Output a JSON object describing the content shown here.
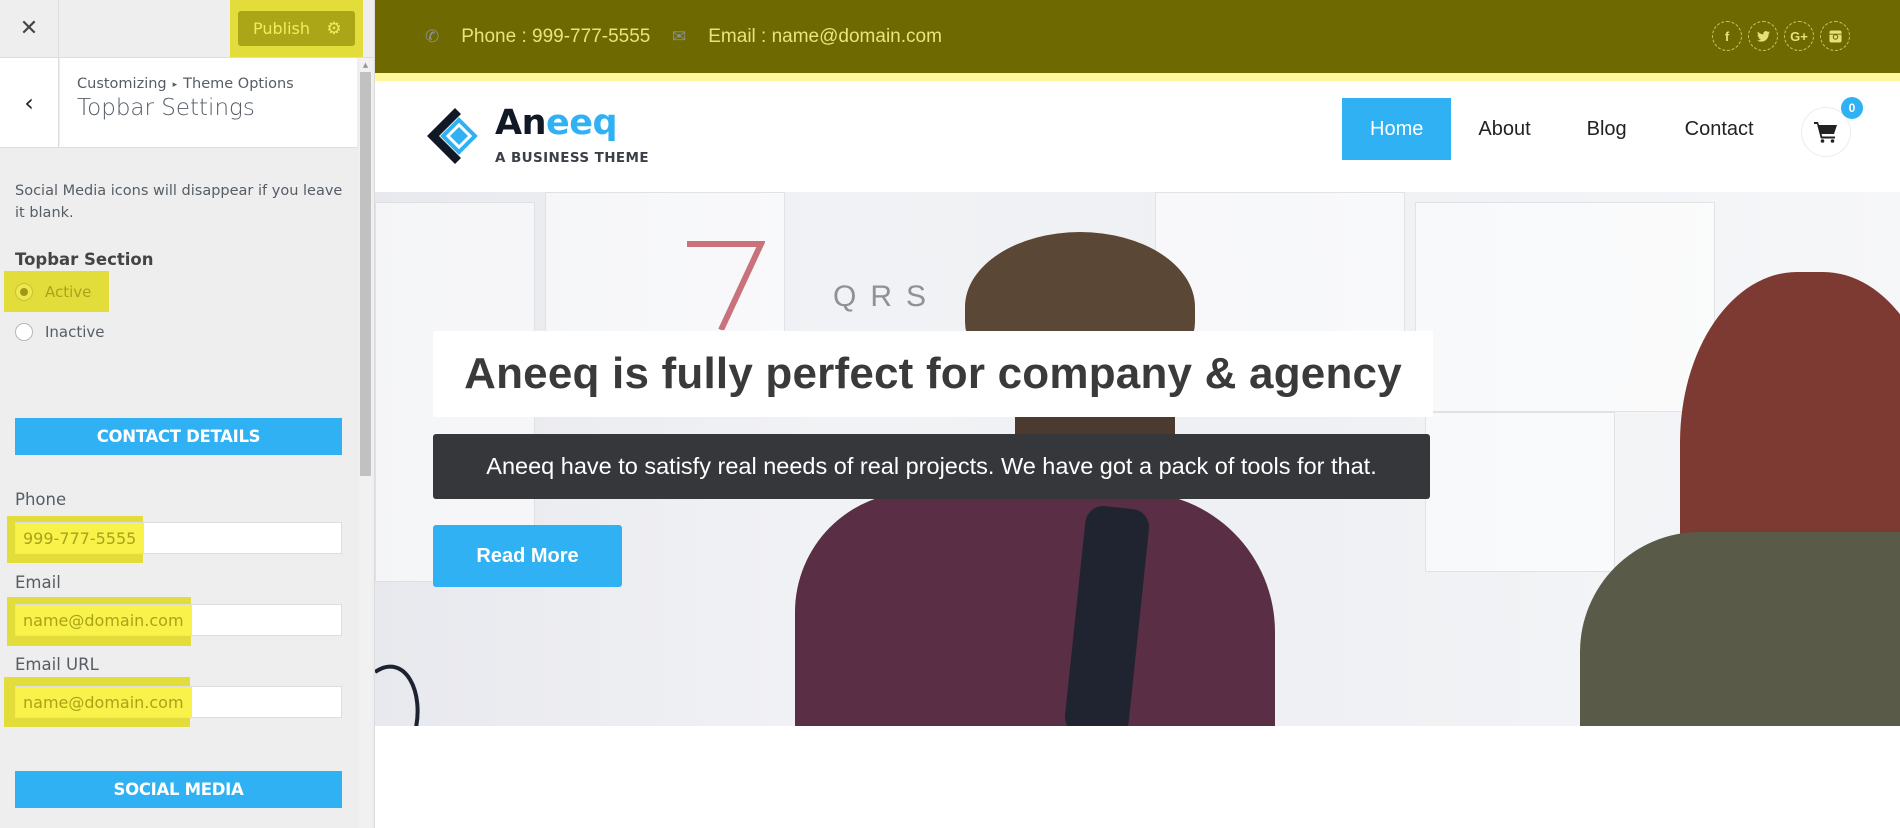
{
  "customizer": {
    "close_icon": "close-icon",
    "publish": {
      "label": "Publish",
      "icon": "gear-icon"
    },
    "back_icon": "chevron-left-icon",
    "breadcrumb": {
      "root": "Customizing",
      "separator": "▸",
      "parent": "Theme Options"
    },
    "section_title": "Topbar Settings",
    "description": "Social Media icons will disappear if you leave it blank.",
    "topbar_section": {
      "label": "Topbar Section",
      "options": [
        {
          "label": "Active",
          "selected": true
        },
        {
          "label": "Inactive",
          "selected": false
        }
      ]
    },
    "contact_details_heading": "CONTACT DETAILS",
    "fields": {
      "phone": {
        "label": "Phone",
        "value": "999-777-5555"
      },
      "email": {
        "label": "Email",
        "value": "name@domain.com"
      },
      "email_url": {
        "label": "Email URL",
        "value": "name@domain.com"
      }
    },
    "social_media_heading": "SOCIAL MEDIA",
    "highlight_color": "#e3dd3c"
  },
  "preview": {
    "topbar": {
      "bg_color": "#6e6900",
      "phone": {
        "icon": "phone-icon",
        "text": "Phone : 999-777-5555"
      },
      "email": {
        "icon": "envelope-icon",
        "text": "Email : name@domain.com"
      },
      "social": [
        {
          "name": "facebook",
          "glyph": "f"
        },
        {
          "name": "twitter",
          "glyph": "t"
        },
        {
          "name": "google-plus",
          "glyph": "G+"
        },
        {
          "name": "instagram",
          "glyph": "◙"
        }
      ]
    },
    "logo": {
      "name_dark": "An",
      "name_blue": "eeq",
      "tagline": "A BUSINESS THEME"
    },
    "nav": {
      "items": [
        {
          "label": "Home",
          "active": true
        },
        {
          "label": "About",
          "active": false
        },
        {
          "label": "Blog",
          "active": false
        },
        {
          "label": "Contact",
          "active": false
        }
      ],
      "cart_count": "0",
      "accent": "#2fb1f4"
    },
    "hero": {
      "headline": "Aneeq is fully perfect for company & agency",
      "subtitle": "Aneeq have to satisfy real needs of real projects. We have got a pack of tools for that.",
      "button": "Read More"
    }
  }
}
